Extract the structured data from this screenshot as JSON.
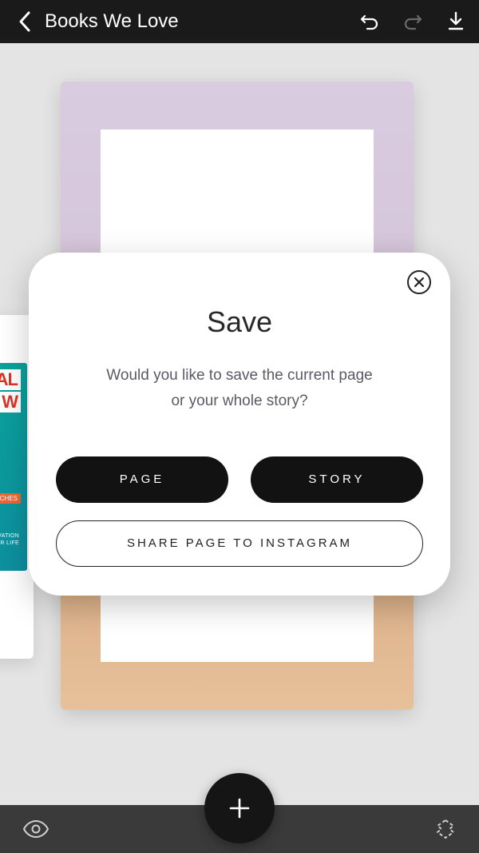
{
  "header": {
    "title": "Books We Love"
  },
  "peek": {
    "line1": "AL",
    "line2": "W",
    "chip": "CHES",
    "small1": "VATION",
    "small2": "UR LIFE"
  },
  "modal": {
    "title": "Save",
    "message_line1": "Would you like to save the current page",
    "message_line2": "or your whole story?",
    "page_label": "PAGE",
    "story_label": "STORY",
    "share_label": "SHARE PAGE TO INSTAGRAM"
  }
}
